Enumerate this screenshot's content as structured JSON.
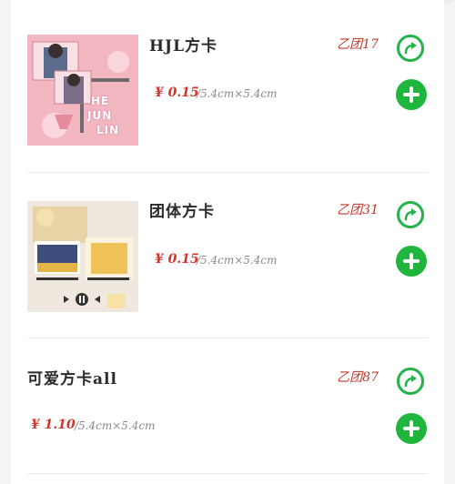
{
  "items": [
    {
      "title": "HJL方卡",
      "tag": "乙团17",
      "price": "¥ 0.15",
      "size": "/5.4cm×5.4cm",
      "thumb_text": [
        "HE",
        "JUN",
        "LIN"
      ],
      "icons": {
        "share": "share-arrow-icon",
        "add": "plus-icon"
      }
    },
    {
      "title": "团体方卡",
      "tag": "乙团31",
      "price": "¥ 0.15",
      "size": "/5.4cm×5.4cm",
      "icons": {
        "share": "share-arrow-icon",
        "add": "plus-icon"
      }
    },
    {
      "title": "可爱方卡all",
      "tag": "乙团87",
      "price": "¥ 1.10",
      "size": "/5.4cm×5.4cm",
      "icons": {
        "share": "share-arrow-icon",
        "add": "plus-icon"
      }
    }
  ],
  "colors": {
    "accent_green": "#20b53d",
    "price_red": "#d7312a",
    "tag_red": "#c0392b"
  }
}
